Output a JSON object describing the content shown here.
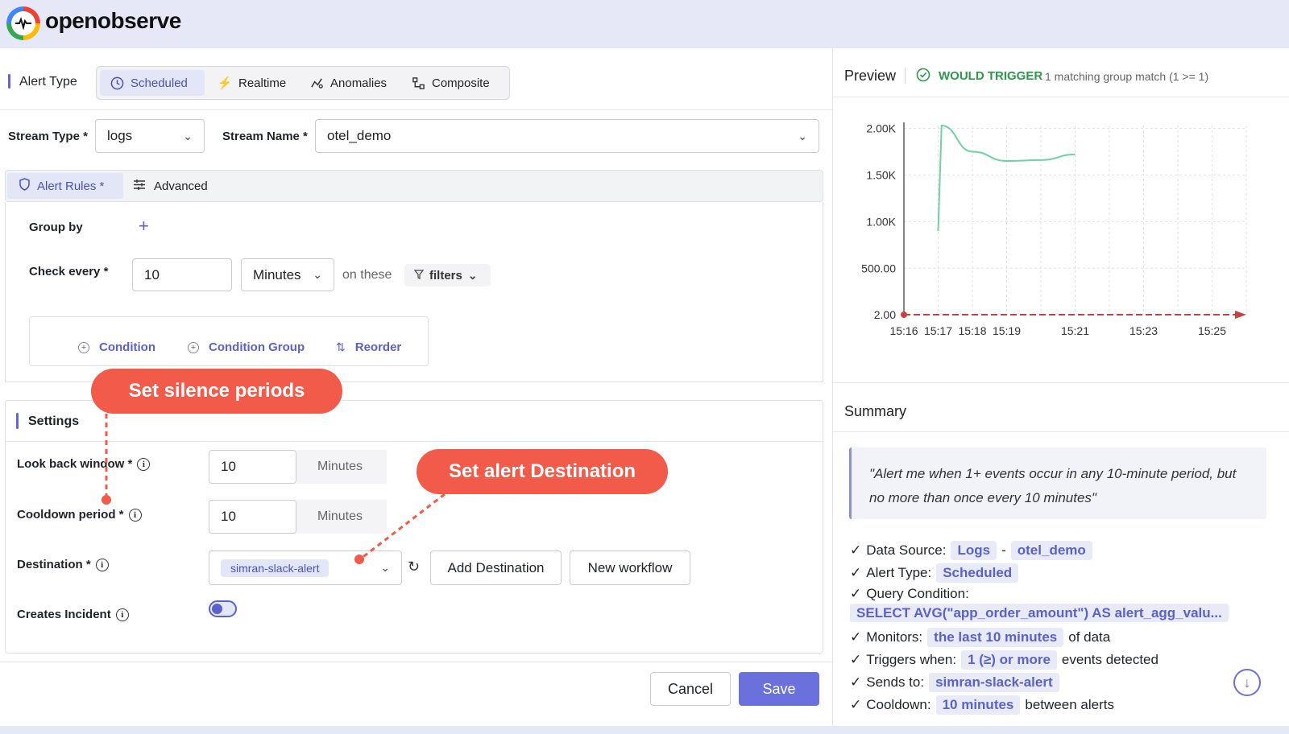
{
  "app": {
    "logo_text": "openobserve"
  },
  "alert_type": {
    "label": "Alert Type",
    "options": [
      "Scheduled",
      "Realtime",
      "Anomalies",
      "Composite"
    ],
    "selected": "Scheduled"
  },
  "stream": {
    "type_label": "Stream Type *",
    "type_value": "logs",
    "name_label": "Stream Name *",
    "name_value": "otel_demo"
  },
  "rules_tabs": {
    "alert_rules": "Alert Rules *",
    "advanced": "Advanced"
  },
  "rules": {
    "group_by": "Group by",
    "check_every": "Check every *",
    "check_every_value": "10",
    "check_every_unit": "Minutes",
    "on_these": "on these",
    "filters": "filters",
    "condition": "Condition",
    "condition_group": "Condition Group",
    "reorder": "Reorder"
  },
  "settings": {
    "title": "Settings",
    "look_back_label": "Look back window *",
    "look_back_value": "10",
    "look_back_unit": "Minutes",
    "cooldown_label": "Cooldown period *",
    "cooldown_value": "10",
    "cooldown_unit": "Minutes",
    "destination_label": "Destination *",
    "destination_value": "simran-slack-alert",
    "add_destination": "Add Destination",
    "new_workflow": "New workflow",
    "creates_incident_label": "Creates Incident",
    "creates_incident_on": false
  },
  "callouts": {
    "silence": "Set silence periods",
    "destination": "Set alert Destination"
  },
  "footer": {
    "cancel": "Cancel",
    "save": "Save"
  },
  "preview": {
    "title": "Preview",
    "status": "WOULD TRIGGER",
    "status_detail": "1 matching group match (1 >= 1)"
  },
  "chart_data": {
    "type": "line",
    "y_ticks": [
      "2.00K",
      "1.50K",
      "1.00K",
      "500.00",
      "2.00"
    ],
    "x_ticks": [
      "15:16",
      "15:17",
      "15:18",
      "15:19",
      "15:21",
      "15:23",
      "15:25"
    ],
    "series": [
      {
        "x": [
          "15:17",
          "15:17",
          "15:18",
          "15:19",
          "15:20",
          "15:21"
        ],
        "values": [
          900,
          2030,
          1750,
          1650,
          1660,
          1720
        ]
      }
    ],
    "threshold": {
      "value": 2
    },
    "grid": true,
    "colors": {
      "series": "#6fd3a0",
      "threshold": "#c9413f"
    }
  },
  "summary": {
    "title": "Summary",
    "quote": "\"Alert me when 1+ events occur in any 10-minute period, but no more than once every 10 minutes\"",
    "data_source_label": "Data Source:",
    "data_source_type": "Logs",
    "data_source_sep": "-",
    "data_source_stream": "otel_demo",
    "alert_type_label": "Alert Type:",
    "alert_type_value": "Scheduled",
    "query_label": "Query Condition:",
    "query_value": "SELECT AVG(\"app_order_amount\") AS alert_agg_valu...",
    "monitors_label": "Monitors:",
    "monitors_value": "the last 10 minutes",
    "monitors_suffix": "of data",
    "triggers_label": "Triggers when:",
    "triggers_value": "1 (≥) or more",
    "triggers_suffix": "events detected",
    "sends_label": "Sends to:",
    "sends_value": "simran-slack-alert",
    "cooldown_label": "Cooldown:",
    "cooldown_value": "10 minutes",
    "cooldown_suffix": "between alerts"
  }
}
